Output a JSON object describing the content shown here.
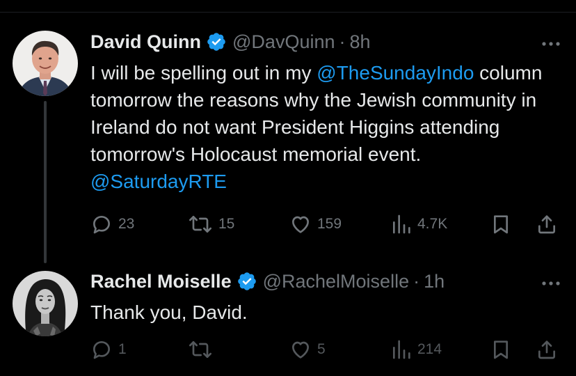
{
  "tweets": [
    {
      "author_name": "David Quinn",
      "handle": "@DavQuinn",
      "separator": "·",
      "time": "8h",
      "text_parts": [
        {
          "text": "I will be spelling out in my ",
          "mention": false
        },
        {
          "text": "@TheSundayIndo",
          "mention": true
        },
        {
          "text": " column tomorrow the reasons why the Jewish community in Ireland do not want President Higgins attending tomorrow's Holocaust memorial event. ",
          "mention": false
        },
        {
          "text": "@SaturdayRTE",
          "mention": true
        }
      ],
      "replies": "23",
      "retweets": "15",
      "likes": "159",
      "views": "4.7K"
    },
    {
      "author_name": "Rachel Moiselle",
      "handle": "@RachelMoiselle",
      "separator": "·",
      "time": "1h",
      "text": "Thank you, David.",
      "replies": "1",
      "retweets": "",
      "likes": "5",
      "views": "214"
    }
  ],
  "icons": {
    "verified": "verified-badge-icon",
    "more": "more-options-icon",
    "reply": "reply-bubble-icon",
    "retweet": "retweet-icon",
    "like": "heart-icon",
    "views": "views-bar-chart-icon",
    "bookmark": "bookmark-icon",
    "share": "share-upload-icon"
  },
  "colors": {
    "background": "#000000",
    "text": "#e7e9ea",
    "secondary": "#71767b",
    "accent": "#1d9bf0",
    "thread_line": "#333639"
  }
}
